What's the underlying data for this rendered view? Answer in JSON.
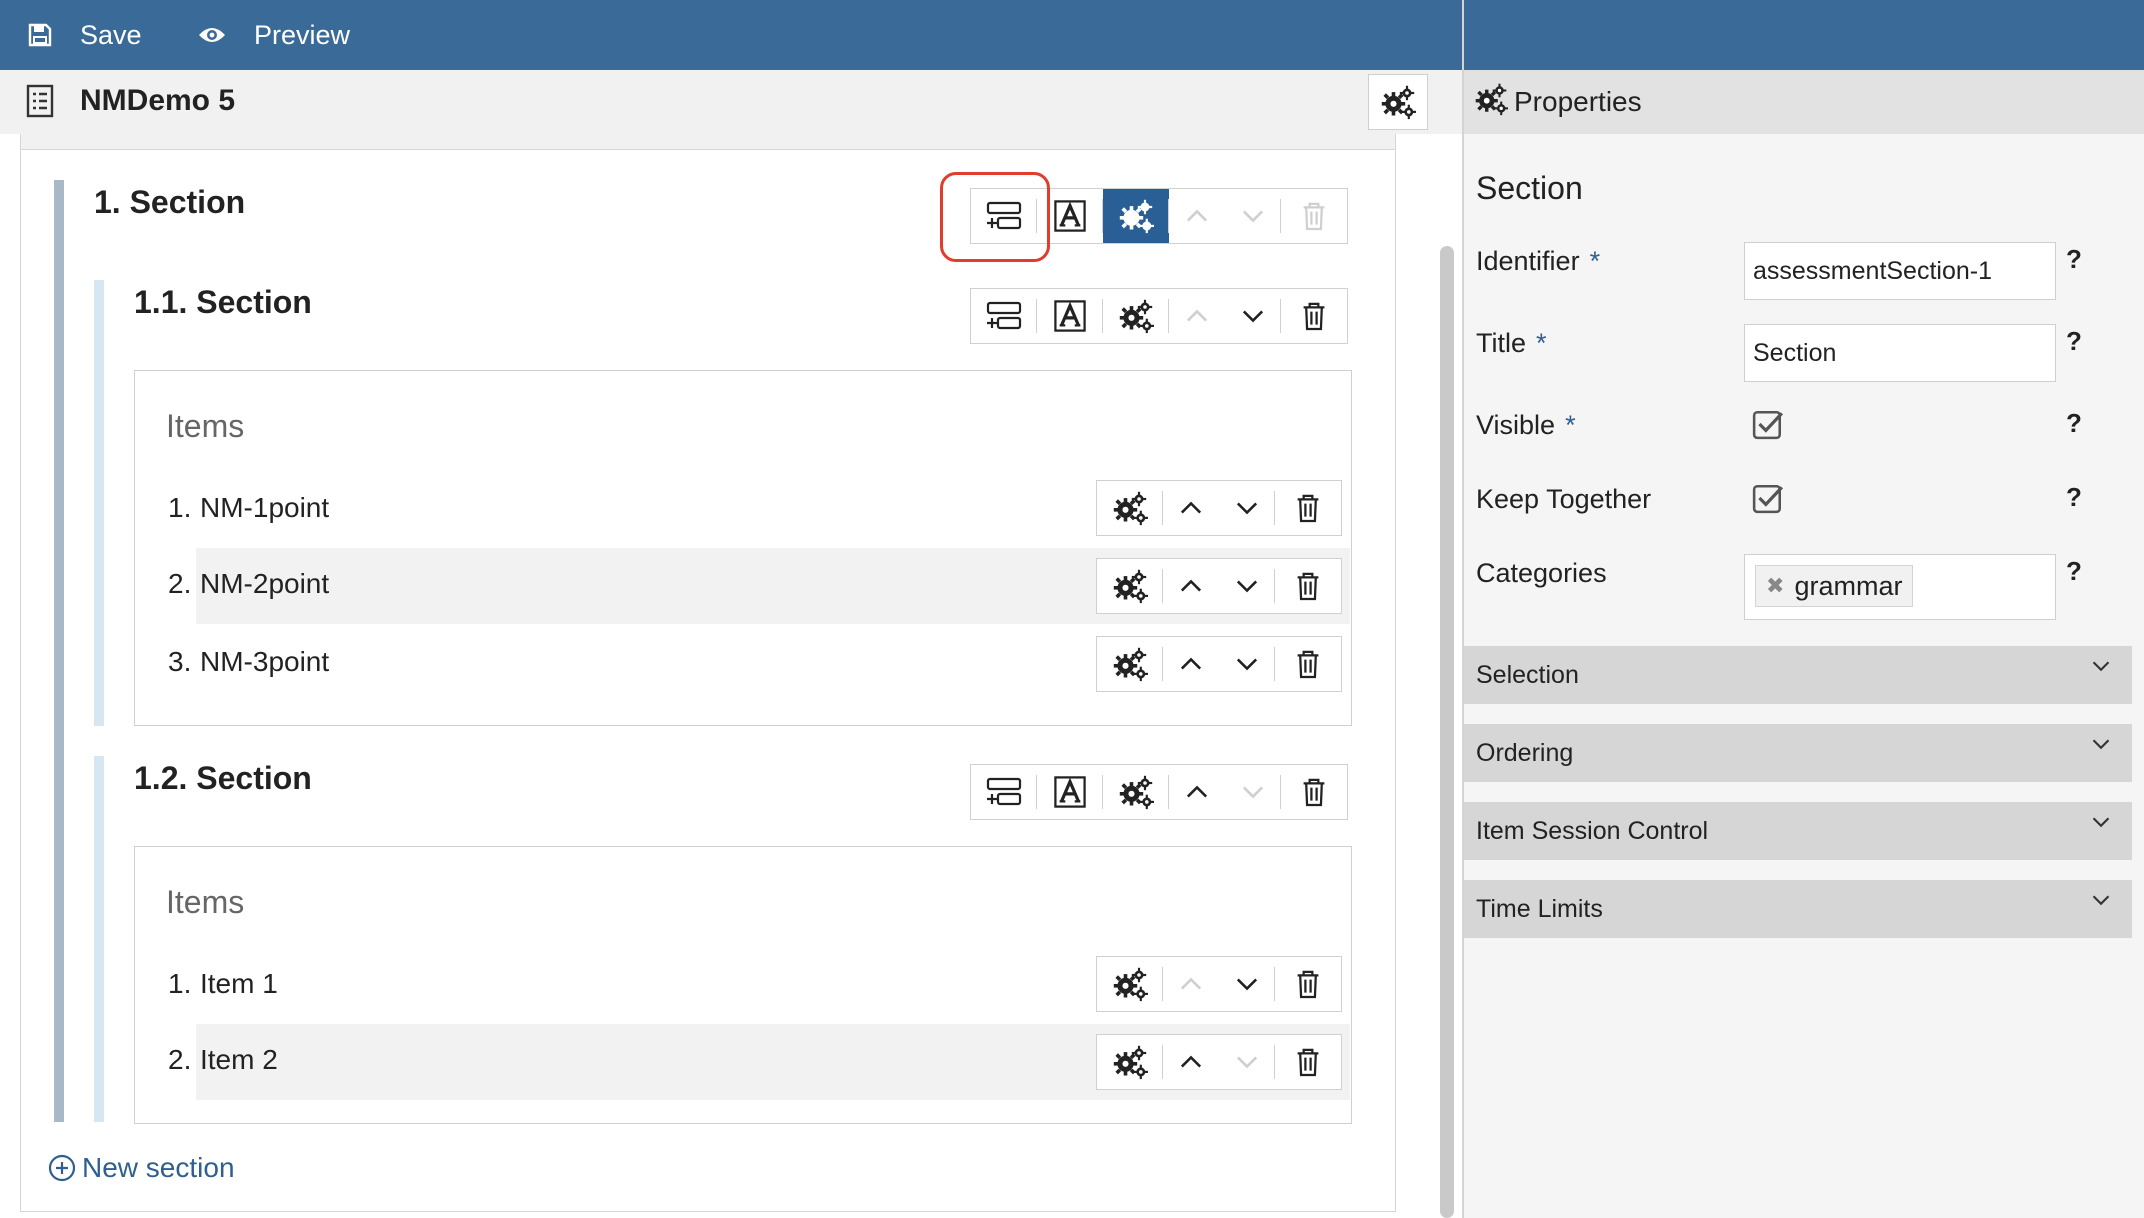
{
  "topbar": {
    "save_label": "Save",
    "preview_label": "Preview"
  },
  "titlebar": {
    "title": "NMDemo 5"
  },
  "sections": {
    "s1": {
      "title": "1. Section"
    },
    "s11": {
      "title": "1.1. Section",
      "items_heading": "Items",
      "items": [
        {
          "number": "1.",
          "label": "NM-1point"
        },
        {
          "number": "2.",
          "label": "NM-2point"
        },
        {
          "number": "3.",
          "label": "NM-3point"
        }
      ]
    },
    "s12": {
      "title": "1.2. Section",
      "items_heading": "Items",
      "items": [
        {
          "number": "1.",
          "label": "Item 1"
        },
        {
          "number": "2.",
          "label": "Item 2"
        }
      ]
    }
  },
  "new_section_label": "New section",
  "properties": {
    "header": "Properties",
    "section_title": "Section",
    "identifier_label": "Identifier",
    "identifier_value": "assessmentSection-1",
    "title_label": "Title",
    "title_value": "Section",
    "visible_label": "Visible",
    "visible_checked": true,
    "keep_together_label": "Keep Together",
    "keep_together_checked": true,
    "categories_label": "Categories",
    "categories": [
      "grammar"
    ],
    "required_mark": "*",
    "help_mark": "?",
    "accordions": [
      "Selection",
      "Ordering",
      "Item Session Control",
      "Time Limits"
    ]
  },
  "colors": {
    "topbar": "#3a6a97",
    "active_button": "#2a5f95",
    "highlight": "#e23c2b",
    "link": "#2e5f8e"
  }
}
